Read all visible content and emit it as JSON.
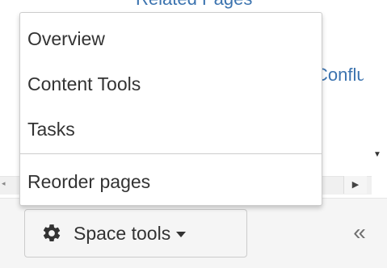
{
  "background": {
    "top_link": "Related Pages",
    "mid_link": "Conflu"
  },
  "menu": {
    "items": [
      "Overview",
      "Content Tools",
      "Tasks"
    ],
    "secondary_items": [
      "Reorder pages"
    ]
  },
  "footer": {
    "space_tools_label": "Space tools",
    "collapse_label": "«"
  },
  "icons": {
    "space_tools": "gear-icon",
    "caret": "caret-down-icon",
    "scroll_down": "scroll-down-arrow-icon",
    "scroll_right": "scroll-right-arrow-icon",
    "scroll_left": "scroll-left-arrow-icon"
  },
  "colors": {
    "link": "#3b73af",
    "text": "#333333",
    "border": "#cccccc",
    "footer_bg": "#f5f5f5"
  }
}
